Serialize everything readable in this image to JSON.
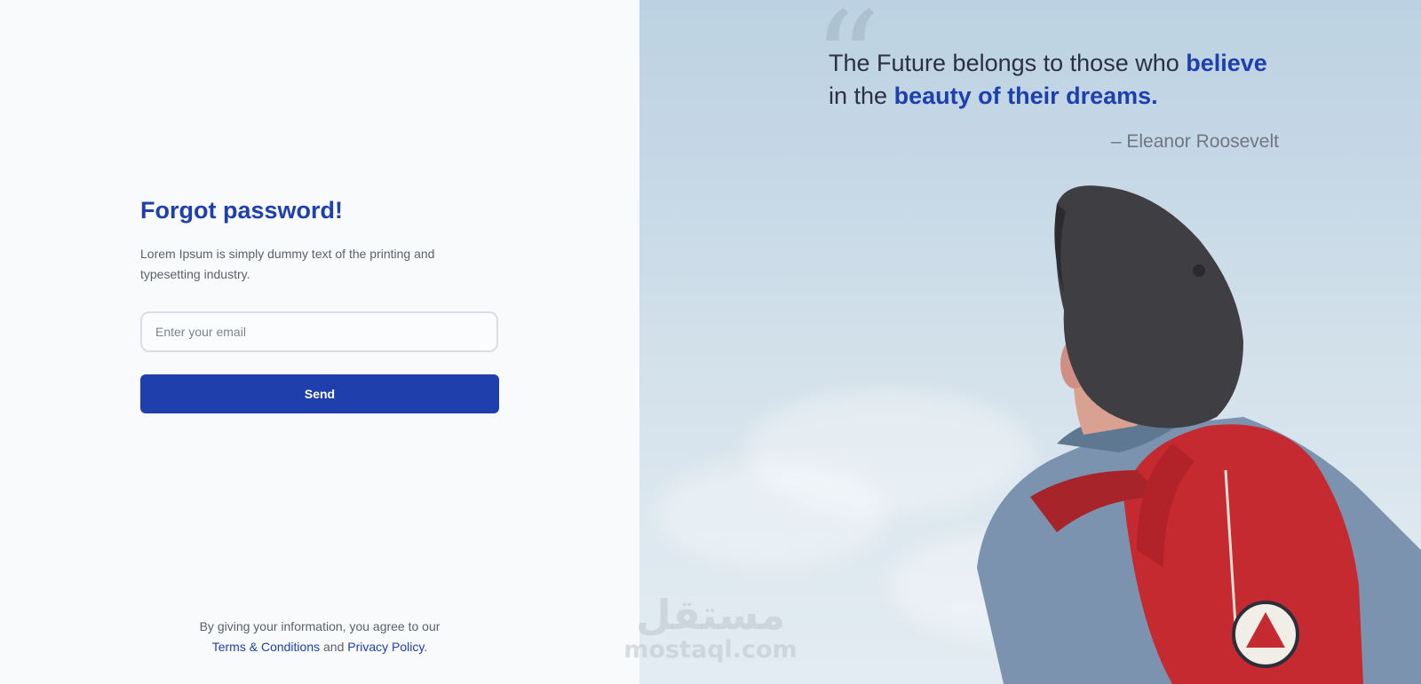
{
  "form": {
    "title": "Forgot password!",
    "description": "Lorem Ipsum is simply dummy text of the printing and typesetting industry.",
    "email_placeholder": "Enter your email",
    "send_label": "Send"
  },
  "footer": {
    "prefix": "By giving your information, you agree to our",
    "terms_link": "Terms & Conditions",
    "and": "and",
    "privacy_link": "Privacy Policy",
    "period": "."
  },
  "quote": {
    "mark": "“",
    "part1": "The Future belongs to those who",
    "highlight1": "believe",
    "part2": "in the",
    "highlight2": "beauty of their dreams.",
    "author": "– Eleanor Roosevelt"
  },
  "watermark": {
    "arabic": "مستقل",
    "latin": "mostaql.com"
  },
  "colors": {
    "accent": "#1e3fae",
    "button": "#1f3fad",
    "text": "#5a5f6b",
    "background": "#f9fafc",
    "backpack": "#c42a2f",
    "cap": "#3d3d40",
    "jacket": "#7d93ad"
  }
}
